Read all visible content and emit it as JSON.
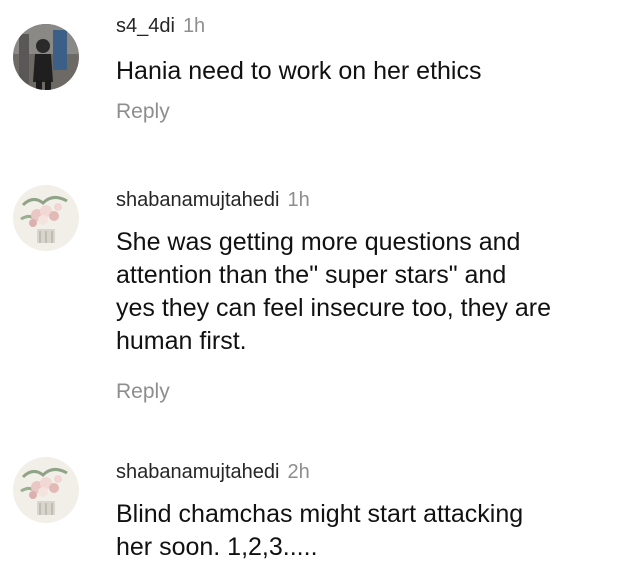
{
  "comments": [
    {
      "username": "s4_4di",
      "time": "1h",
      "text": "Hania need to work on her ethics",
      "reply_label": "Reply"
    },
    {
      "username": "shabanamujtahedi",
      "time": "1h",
      "text": "She was getting more questions and\nattention than the\" super stars\" and\nyes they can feel insecure too, they are\nhuman first.",
      "reply_label": "Reply"
    },
    {
      "username": "shabanamujtahedi",
      "time": "2h",
      "text": "Blind chamchas might start attacking\nher soon. 1,2,3.....",
      "reply_label": ""
    }
  ],
  "colors": {
    "username": "#262626",
    "time": "#8e8e8e",
    "reply": "#8e8e8e",
    "text": "#111111"
  },
  "icons": {
    "avatar_1": "profile-photo-dark",
    "avatar_2": "flower-bouquet-avatar",
    "avatar_3": "flower-bouquet-avatar"
  }
}
